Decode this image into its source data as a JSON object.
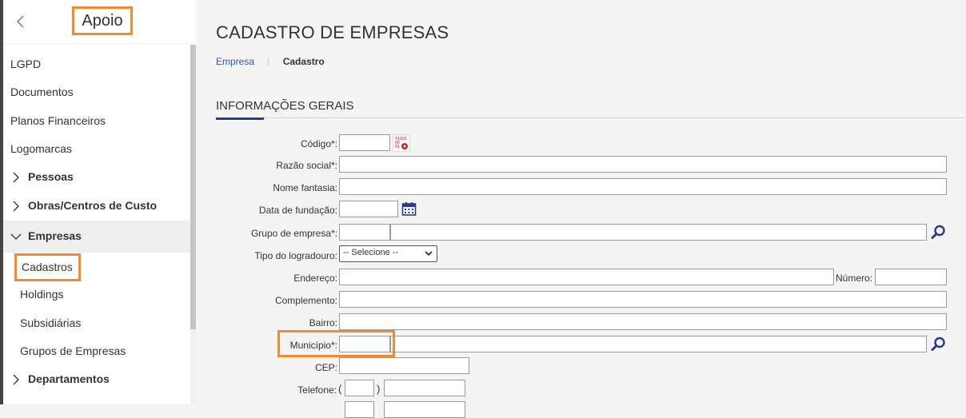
{
  "sidebar": {
    "title": "Apoio",
    "items": [
      {
        "label": "LGPD"
      },
      {
        "label": "Documentos"
      },
      {
        "label": "Planos Financeiros"
      },
      {
        "label": "Logomarcas"
      }
    ],
    "groups": [
      {
        "label": "Pessoas",
        "expanded": false
      },
      {
        "label": "Obras/Centros de Custo",
        "expanded": false
      },
      {
        "label": "Empresas",
        "expanded": true
      },
      {
        "label": "Departamentos",
        "expanded": false
      }
    ],
    "empresas_sub": [
      {
        "label": "Cadastros",
        "active": true
      },
      {
        "label": "Holdings"
      },
      {
        "label": "Subsidiárias"
      },
      {
        "label": "Grupos de Empresas"
      }
    ]
  },
  "page": {
    "title": "CADASTRO DE EMPRESAS",
    "breadcrumb": [
      "Empresa",
      "Cadastro"
    ],
    "section": "INFORMAÇÕES GERAIS"
  },
  "form": {
    "codigo_label": "Código*:",
    "razao_label": "Razão social*:",
    "fantasia_label": "Nome fantasia:",
    "fundacao_label": "Data de fundação:",
    "grupo_label": "Grupo de empresa*:",
    "logradouro_label": "Tipo do logradouro:",
    "logradouro_value": "-- Selecione --",
    "endereco_label": "Endereço:",
    "numero_label": "Número:",
    "complemento_label": "Complemento:",
    "bairro_label": "Bairro:",
    "municipio_label": "Município*:",
    "cep_label": "CEP:",
    "telefone_label": "Telefone:",
    "paren_open": "(",
    "paren_close": ")",
    "codigo_icon_text": "01001 00 01"
  },
  "colors": {
    "highlight": "#f28a30",
    "accent": "#2a3a8c",
    "link": "#2a5aa8"
  },
  "icons": [
    "chevron-left-icon",
    "chevron-right-icon",
    "chevron-down-icon",
    "code-generator-icon",
    "calendar-icon",
    "search-icon"
  ]
}
